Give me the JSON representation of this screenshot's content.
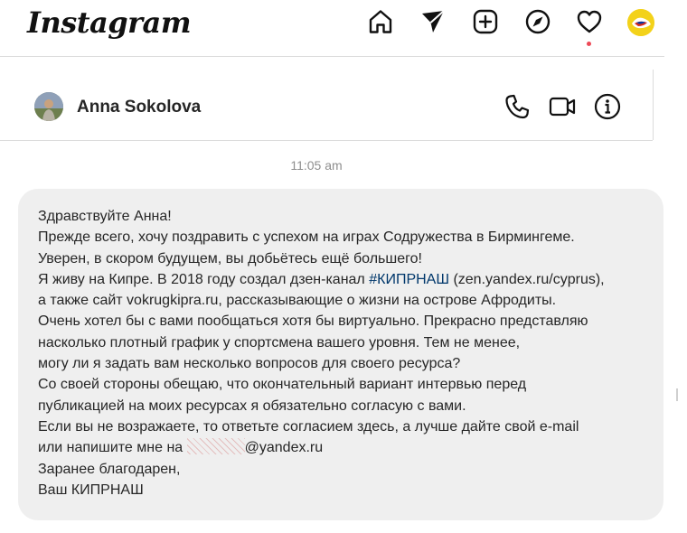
{
  "app": {
    "logo_text": "Instagram"
  },
  "nav": {
    "icons": [
      "home-icon",
      "direct-send-icon",
      "new-post-icon",
      "explore-compass-icon",
      "activity-heart-icon",
      "profile-avatar"
    ],
    "has_notification": true
  },
  "chat": {
    "contact_name": "Anna Sokolova",
    "header_icons": [
      "phone-icon",
      "video-call-icon",
      "info-icon"
    ],
    "timestamp": "11:05 am",
    "message": {
      "lines": [
        "Здравствуйте Анна!",
        "Прежде всего, хочу поздравить с успехом на играх  Содружества в Бирмингеме.",
        "Уверен, в скором будущем, вы добьётесь ещё большего!",
        "Я живу на Кипре. В 2018 году  создал дзен-канал ",
        " (zen.yandex.ru/cyprus),",
        "а также сайт vokrugkipra.ru, рассказывающие о жизни на  острове Афродиты.",
        "Очень хотел бы с вами  пообщаться хотя бы  виртуально. Прекрасно  представляю",
        "насколько плотный график у спортсмена  вашего уровня. Тем не менее,",
        "могу ли я задать вам несколько вопросов для  своего ресурса?",
        "Со своей стороны обещаю, что окончательный вариант интервью перед",
        "публикацией  на моих ресурсах я обязательно согласую с вами.",
        "Если вы не возражаете, то ответьте согласием здесь, а лучше дайте свой e-mail",
        "или напишите мне на ",
        "@yandex.ru",
        "Заранее благодарен,",
        "Ваш КИПРНАШ"
      ],
      "hashtag": "#КИПРНАШ"
    }
  },
  "colors": {
    "bubble_bg": "#efefef",
    "notification_dot": "#ed4956",
    "divider": "#dbdbdb",
    "timestamp_text": "#8e8e8e"
  }
}
